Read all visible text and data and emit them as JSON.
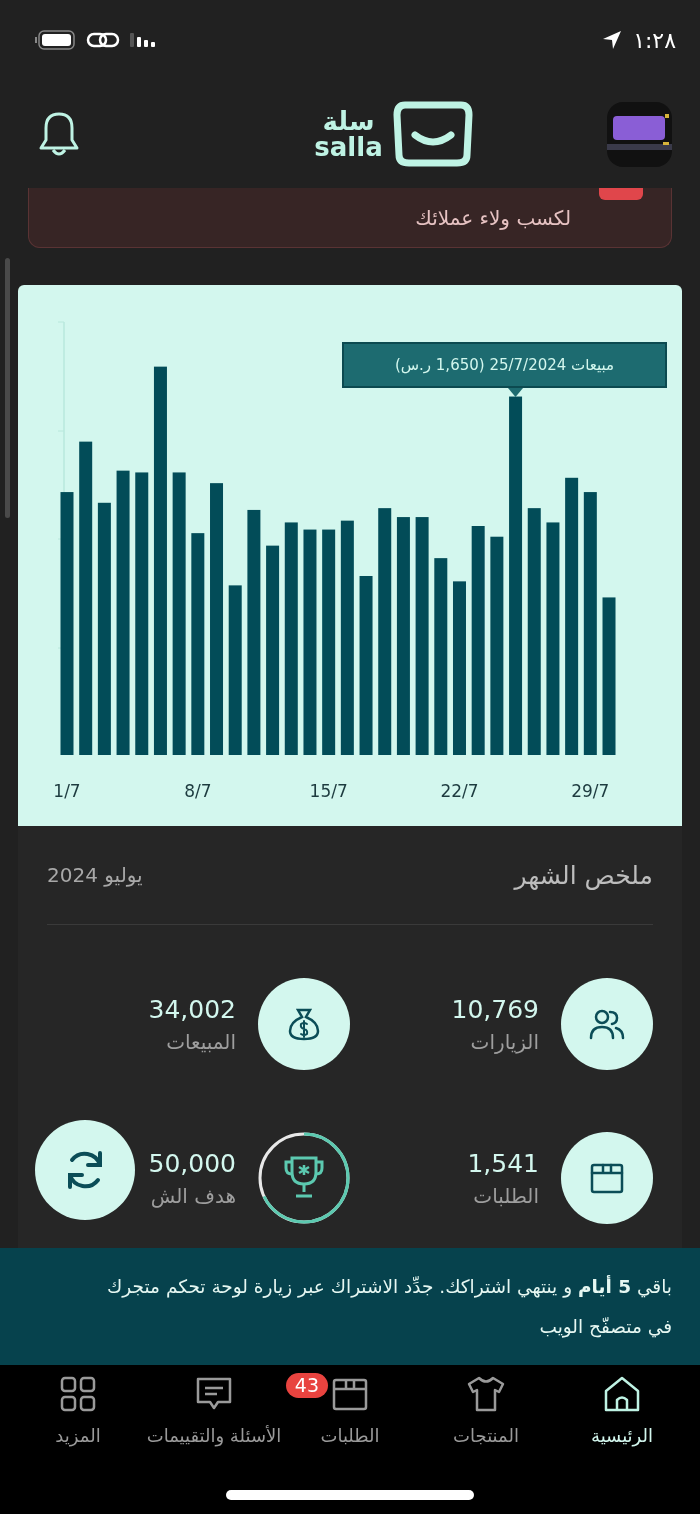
{
  "status_bar": {
    "time": "١:٢٨"
  },
  "header": {
    "logo_arabic": "سلة",
    "logo_latin": "salla"
  },
  "notice": {
    "text": "لكسب ولاء عملائك"
  },
  "chart": {
    "tooltip": "مبيعات 25/7/2024 (1,650 ر.س)",
    "x_labels": [
      "29/7",
      "22/7",
      "15/7",
      "8/7",
      "1/7"
    ]
  },
  "summary": {
    "title": "ملخص الشهر",
    "period": "يوليو 2024",
    "stats": [
      {
        "kind": "visits",
        "value": "10,769",
        "label": "الزيارات"
      },
      {
        "kind": "sales",
        "value": "34,002",
        "label": "المبيعات"
      },
      {
        "kind": "orders",
        "value": "1,541",
        "label": "الطلبات"
      },
      {
        "kind": "goal",
        "value": "50,000",
        "label": "هدف الش"
      }
    ]
  },
  "banner": {
    "text": "باقي **5 أيام** و ينتهي اشتراكك. جدِّد الاشتراك عبر زيارة لوحة تحكم متجرك في متصفّح الويب"
  },
  "nav": [
    {
      "kind": "home",
      "label": "الرئيسية",
      "selected": true
    },
    {
      "kind": "products",
      "label": "المنتجات",
      "selected": false
    },
    {
      "kind": "orders",
      "label": "الطلبات",
      "selected": false,
      "badge": "43"
    },
    {
      "kind": "reviews",
      "label": "الأسئلة والتقييمات",
      "selected": false
    },
    {
      "kind": "more",
      "label": "المزيد",
      "selected": false
    }
  ]
}
